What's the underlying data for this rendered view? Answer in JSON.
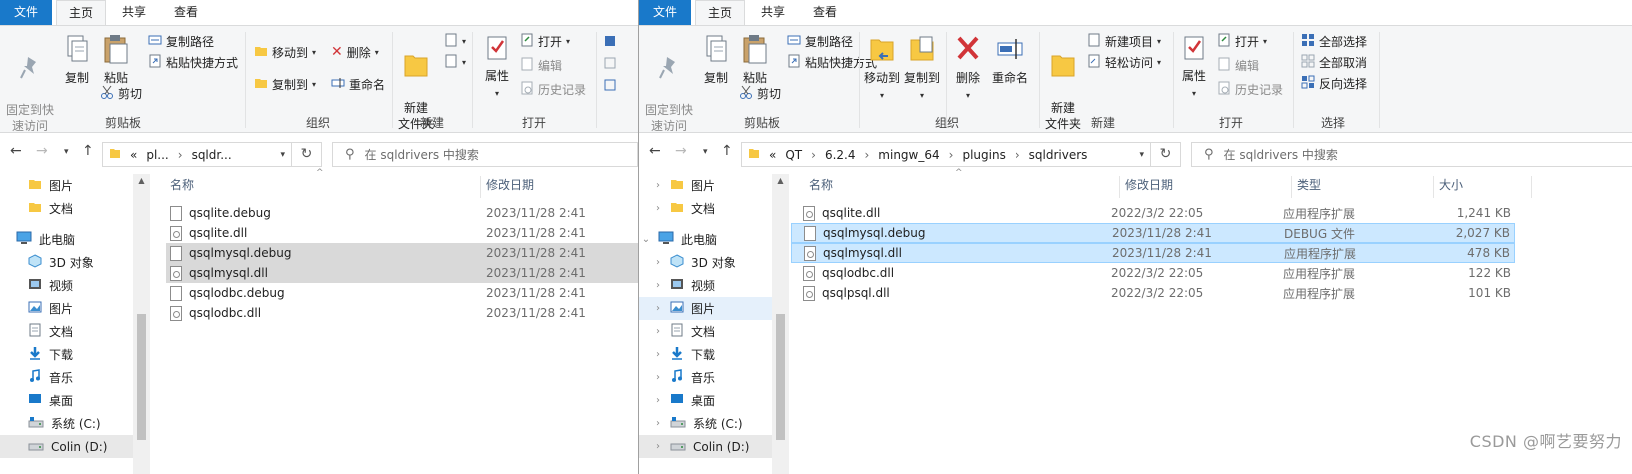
{
  "left": {
    "tabs": [
      "文件",
      "主页",
      "共享",
      "查看"
    ],
    "ribbon": {
      "pin_quick": "固定到快\n速访问",
      "copy": "复制",
      "paste": "粘贴",
      "copy_path": "复制路径",
      "paste_shortcut": "粘贴快捷方式",
      "cut": "剪切",
      "move_to": "移动到",
      "copy_to": "复制到",
      "delete": "删除",
      "rename": "重命名",
      "new_folder": "新建\n文件夹",
      "properties": "属性",
      "open": "打开",
      "edit": "编辑",
      "history": "历史记录",
      "group_clipboard": "剪贴板",
      "group_organize": "组织",
      "group_new": "新建",
      "group_open": "打开"
    },
    "breadcrumb": [
      "«",
      "pl...",
      "sqldr..."
    ],
    "search_placeholder": "在 sqldrivers 中搜索",
    "nav": {
      "items": [
        {
          "label": "图片",
          "icon": "folder-icon"
        },
        {
          "label": "文档",
          "icon": "folder-icon"
        },
        {
          "label": "此电脑",
          "icon": "computer-icon"
        },
        {
          "label": "3D 对象",
          "icon": "cube-icon"
        },
        {
          "label": "视频",
          "icon": "video-icon"
        },
        {
          "label": "图片",
          "icon": "picture-icon"
        },
        {
          "label": "文档",
          "icon": "document-icon"
        },
        {
          "label": "下载",
          "icon": "download-icon"
        },
        {
          "label": "音乐",
          "icon": "music-icon"
        },
        {
          "label": "桌面",
          "icon": "desktop-icon"
        },
        {
          "label": "系统 (C:)",
          "icon": "drive-c-icon"
        },
        {
          "label": "Colin (D:)",
          "icon": "drive-icon"
        }
      ]
    },
    "columns": {
      "name": "名称",
      "date": "修改日期"
    },
    "files": [
      {
        "name": "qsqlite.debug",
        "date": "2023/11/28 2:41",
        "kind": "debug",
        "state": ""
      },
      {
        "name": "qsqlite.dll",
        "date": "2023/11/28 2:41",
        "kind": "dll",
        "state": ""
      },
      {
        "name": "qsqlmysql.debug",
        "date": "2023/11/28 2:41",
        "kind": "debug",
        "state": "gsel"
      },
      {
        "name": "qsqlmysql.dll",
        "date": "2023/11/28 2:41",
        "kind": "dll",
        "state": "gsel"
      },
      {
        "name": "qsqlodbc.debug",
        "date": "2023/11/28 2:41",
        "kind": "debug",
        "state": ""
      },
      {
        "name": "qsqlodbc.dll",
        "date": "2023/11/28 2:41",
        "kind": "dll",
        "state": ""
      }
    ]
  },
  "right": {
    "tabs": [
      "文件",
      "主页",
      "共享",
      "查看"
    ],
    "ribbon": {
      "pin_quick": "固定到快\n速访问",
      "copy": "复制",
      "paste": "粘贴",
      "copy_path": "复制路径",
      "paste_shortcut": "粘贴快捷方式",
      "cut": "剪切",
      "move_to": "移动到",
      "copy_to": "复制到",
      "delete": "删除",
      "rename": "重命名",
      "new_folder": "新建\n文件夹",
      "new_item": "新建项目",
      "easy_access": "轻松访问",
      "properties": "属性",
      "open": "打开",
      "edit": "编辑",
      "history": "历史记录",
      "select_all": "全部选择",
      "select_none": "全部取消",
      "invert": "反向选择",
      "group_clipboard": "剪贴板",
      "group_organize": "组织",
      "group_new": "新建",
      "group_open": "打开",
      "group_select": "选择"
    },
    "breadcrumb": [
      "«",
      "QT",
      "6.2.4",
      "mingw_64",
      "plugins",
      "sqldrivers"
    ],
    "search_placeholder": "在 sqldrivers 中搜索",
    "nav": {
      "items": [
        {
          "label": "图片",
          "icon": "folder-icon"
        },
        {
          "label": "文档",
          "icon": "folder-icon"
        },
        {
          "label": "此电脑",
          "icon": "computer-icon"
        },
        {
          "label": "3D 对象",
          "icon": "cube-icon"
        },
        {
          "label": "视频",
          "icon": "video-icon"
        },
        {
          "label": "图片",
          "icon": "picture-icon"
        },
        {
          "label": "文档",
          "icon": "document-icon"
        },
        {
          "label": "下载",
          "icon": "download-icon"
        },
        {
          "label": "音乐",
          "icon": "music-icon"
        },
        {
          "label": "桌面",
          "icon": "desktop-icon"
        },
        {
          "label": "系统 (C:)",
          "icon": "drive-c-icon"
        },
        {
          "label": "Colin (D:)",
          "icon": "drive-icon"
        }
      ]
    },
    "columns": {
      "name": "名称",
      "date": "修改日期",
      "type": "类型",
      "size": "大小"
    },
    "files": [
      {
        "name": "qsqlite.dll",
        "date": "2022/3/2 22:05",
        "type": "应用程序扩展",
        "size": "1,241 KB",
        "kind": "dll",
        "state": ""
      },
      {
        "name": "qsqlmysql.debug",
        "date": "2023/11/28 2:41",
        "type": "DEBUG 文件",
        "size": "2,027 KB",
        "kind": "debug",
        "state": "sel"
      },
      {
        "name": "qsqlmysql.dll",
        "date": "2023/11/28 2:41",
        "type": "应用程序扩展",
        "size": "478 KB",
        "kind": "dll",
        "state": "sel"
      },
      {
        "name": "qsqlodbc.dll",
        "date": "2022/3/2 22:05",
        "type": "应用程序扩展",
        "size": "122 KB",
        "kind": "dll",
        "state": ""
      },
      {
        "name": "qsqlpsql.dll",
        "date": "2022/3/2 22:05",
        "type": "应用程序扩展",
        "size": "101 KB",
        "kind": "dll",
        "state": ""
      }
    ]
  },
  "watermark": "CSDN @啊艺要努力",
  "colors": {
    "accent": "#1979ca",
    "selection": "#cce8ff",
    "folder": "#f7c843"
  }
}
